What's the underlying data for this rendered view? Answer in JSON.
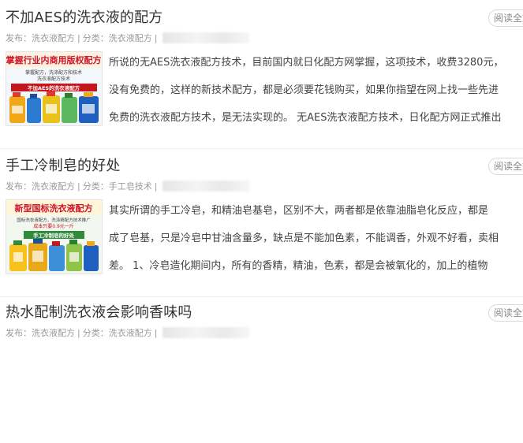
{
  "common": {
    "read_all_label": "阅读全文",
    "meta_sep": "|"
  },
  "articles": [
    {
      "title": "不加AES的洗衣液的配方",
      "published_label": "发布：洗衣液配方",
      "category_label": "分类：洗衣液配方",
      "thumb": {
        "headline": "掌握行业内商用版权配方",
        "subline_1": "掌握配方，洗涤配方和技术",
        "subline_2": "洗衣液配方技术",
        "banner": "不加AES的洗衣液配方",
        "headline_color": "#d0122b",
        "banner_color": "#c4161c"
      },
      "excerpt_lines": [
        "所说的无AES洗衣液配方技术，目前国内就日化配方网掌握，这项技术，收费3280元，",
        "没有免费的，这样的新技术配方，都是必须要花钱购买，如果你指望在网上找一些先进",
        "免费的洗衣液配方技术，是无法实现的。 无AES洗衣液配方技术，日化配方网正式推出"
      ]
    },
    {
      "title": "手工冷制皂的好处",
      "published_label": "发布：洗衣液配方",
      "category_label": "分类：手工皂技术",
      "thumb": {
        "headline": "新型国标洗衣液配方",
        "subline_1": "国标洗衣液配方，洗涤精配方技术推广",
        "subline_2": "成本只要0.9元一斤",
        "banner": "手工冷制皂的好处",
        "headline_color": "#d0122b",
        "banner_color": "#2e8b3a"
      },
      "excerpt_lines": [
        "其实所谓的手工冷皂，和精油皂基皂，区别不大，两者都是依靠油脂皂化反应，都是",
        "成了皂基，只是冷皂中甘油含量多，缺点是不能加色素，不能调香，外观不好看，卖相",
        "差。 1、冷皂造化期间内，所有的香精，精油，色素，都是会被氧化的，加上的植物"
      ]
    },
    {
      "title": "热水配制洗衣液会影响香味吗",
      "published_label": "发布：洗衣液配方",
      "category_label": "分类：洗衣液配方"
    }
  ]
}
